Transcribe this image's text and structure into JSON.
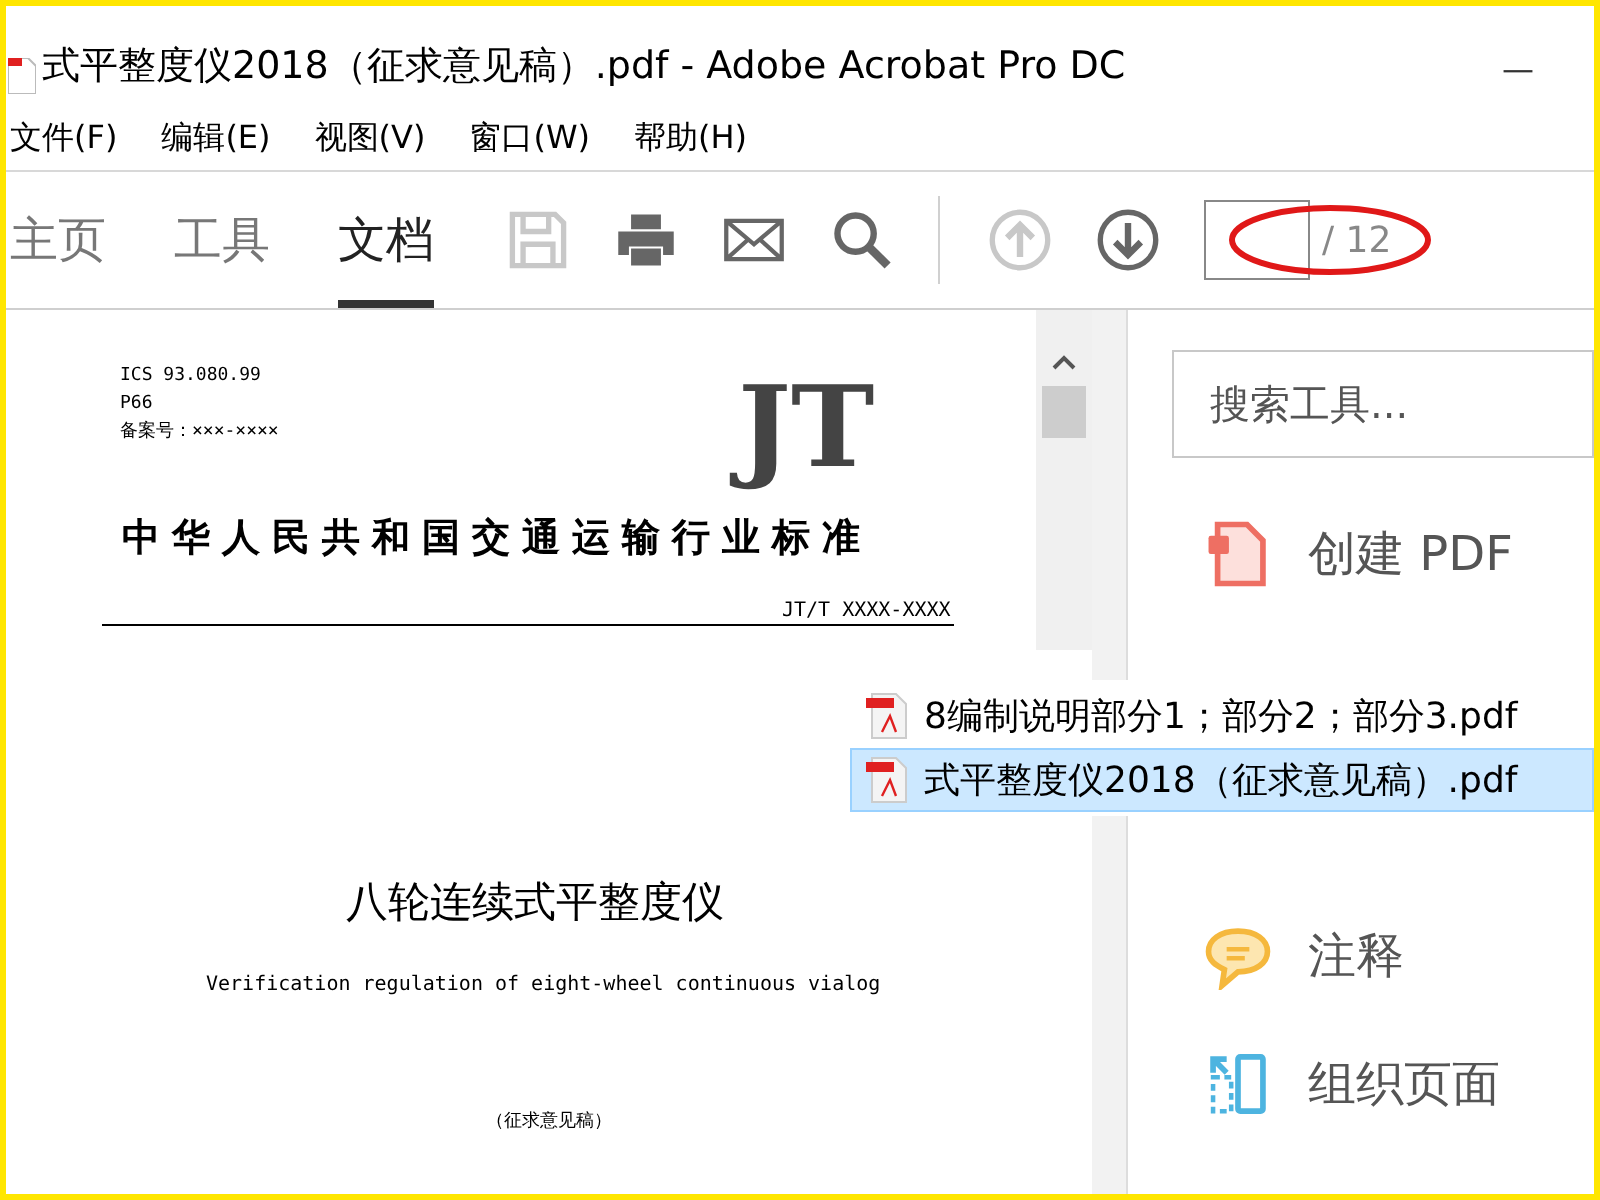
{
  "window": {
    "title": "式平整度仪2018（征求意见稿）.pdf - Adobe Acrobat Pro DC",
    "minimize": "—"
  },
  "menu": [
    "文件(F)",
    "编辑(E)",
    "视图(V)",
    "窗口(W)",
    "帮助(H)"
  ],
  "tabs": [
    {
      "label": "主页",
      "selected": false
    },
    {
      "label": "工具",
      "selected": false
    },
    {
      "label": "文档",
      "selected": true
    }
  ],
  "toolbar": [
    {
      "kind": "save",
      "disabled": true
    },
    {
      "kind": "print",
      "disabled": false
    },
    {
      "kind": "mail",
      "disabled": false
    },
    {
      "kind": "search",
      "disabled": false
    },
    {
      "kind": "up",
      "disabled": true
    },
    {
      "kind": "down",
      "disabled": false
    }
  ],
  "page_field": {
    "total": "/ 12"
  },
  "document": {
    "ics": "ICS  93.080.99",
    "class_code": "P66",
    "record": "备案号：×××-××××",
    "logo": "JT",
    "standard": "中华人民共和国交通运输行业标准",
    "code": "JT/T XXXX-XXXX",
    "title": "八轮连续式平整度仪",
    "subtitle": "Verification regulation of eight-wheel continuous vialog",
    "note": "（征求意见稿）"
  },
  "tools_pane": {
    "search_placeholder": "搜索工具...",
    "tools": [
      {
        "kind": "create",
        "label": "创建 PDF"
      },
      {
        "kind": "comment",
        "label": "注释"
      },
      {
        "kind": "organize",
        "label": "组织页面"
      }
    ]
  },
  "file_list": [
    {
      "name": "8编制说明部分1；部分2；部分3.pdf",
      "selected": false
    },
    {
      "name": "式平整度仪2018（征求意见稿）.pdf",
      "selected": true
    }
  ]
}
